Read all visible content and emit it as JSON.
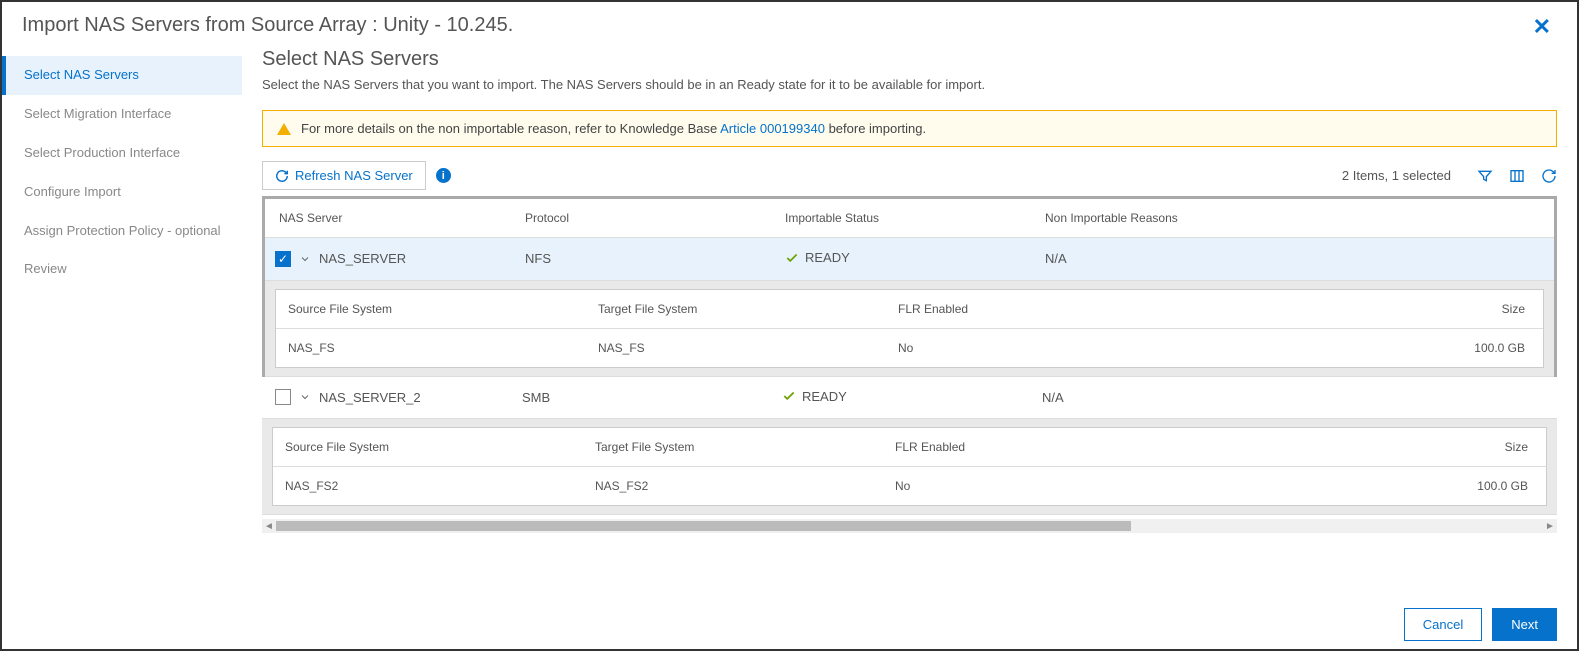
{
  "header": {
    "title": "Import NAS Servers from Source Array : Unity - 10.245."
  },
  "sidebar": {
    "steps": [
      "Select NAS Servers",
      "Select Migration Interface",
      "Select Production Interface",
      "Configure Import",
      "Assign Protection Policy - optional",
      "Review"
    ]
  },
  "main": {
    "title": "Select NAS Servers",
    "subtitle": "Select the NAS Servers that you want to import. The NAS Servers should be in an Ready state for it to be available for import.",
    "banner_pre": "For more details on the non importable reason, refer to Knowledge Base ",
    "banner_link": "Article 000199340",
    "banner_post": " before importing.",
    "refresh": "Refresh NAS Server",
    "status": "2 Items, 1 selected",
    "columns": {
      "c0": "NAS Server",
      "c1": "Protocol",
      "c2": "Importable Status",
      "c3": "Non Importable Reasons"
    },
    "rows": [
      {
        "name": "NAS_SERVER",
        "protocol": "NFS",
        "status": "READY",
        "reasons": "N/A",
        "selected": true,
        "fs": {
          "src": "NAS_FS",
          "tgt": "NAS_FS",
          "flr": "No",
          "size": "100.0 GB"
        }
      },
      {
        "name": "NAS_SERVER_2",
        "protocol": "SMB",
        "status": "READY",
        "reasons": "N/A",
        "selected": false,
        "fs": {
          "src": "NAS_FS2",
          "tgt": "NAS_FS2",
          "flr": "No",
          "size": "100.0 GB"
        }
      }
    ],
    "sub_columns": {
      "c0": "Source File System",
      "c1": "Target File System",
      "c2": "FLR Enabled",
      "c3": "Size"
    }
  },
  "footer": {
    "cancel": "Cancel",
    "next": "Next"
  }
}
